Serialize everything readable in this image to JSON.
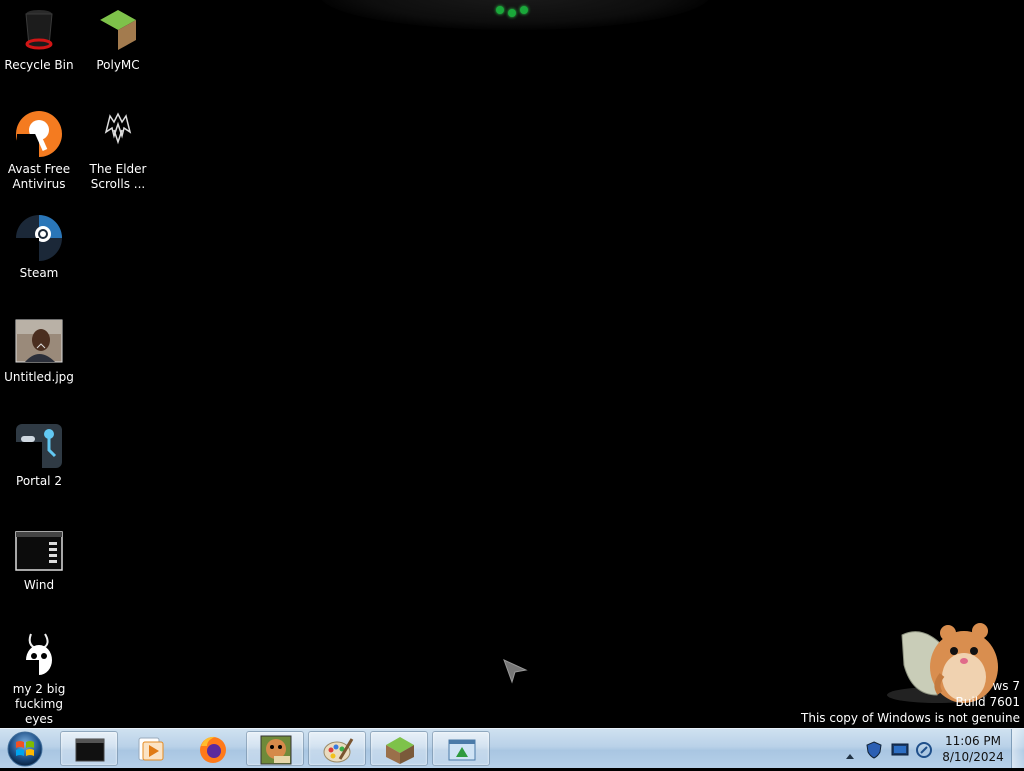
{
  "desktop": {
    "icons": [
      {
        "label": "Recycle Bin",
        "icon": "recycle-bin-icon"
      },
      {
        "label": "PolyMC",
        "icon": "polymc-icon"
      },
      {
        "label": "Avast Free\nAntivirus",
        "icon": "avast-icon"
      },
      {
        "label": "The Elder\nScrolls ...",
        "icon": "elder-scrolls-icon"
      },
      {
        "label": "Steam",
        "icon": "steam-icon"
      },
      {
        "label": "Untitled.jpg",
        "icon": "image-file-icon"
      },
      {
        "label": "Portal 2",
        "icon": "portal-2-icon"
      },
      {
        "label": "Wind",
        "icon": "wind-shortcut-icon"
      },
      {
        "label": "my 2 big\nfuckimg eyes",
        "icon": "bunny-image-icon"
      }
    ]
  },
  "watermark": {
    "line1": "ws 7",
    "line2": "Build 7601",
    "line3": "This copy of Windows is not genuine"
  },
  "taskbar": {
    "start_icon": "windows-orb-icon",
    "buttons": [
      {
        "icon": "cmd-window-icon",
        "active": true
      },
      {
        "icon": "media-player-icon",
        "active": false
      },
      {
        "icon": "firefox-icon",
        "active": false
      },
      {
        "icon": "hamster-box-icon",
        "active": true
      },
      {
        "icon": "paint-icon",
        "active": true
      },
      {
        "icon": "minecraft-icon",
        "active": true
      },
      {
        "icon": "app-window-icon",
        "active": true
      }
    ],
    "tray": {
      "icons": [
        "show-hidden-icons-arrow",
        "security-shield-icon",
        "network-monitor-icon",
        "volume-icon"
      ]
    },
    "clock": {
      "time": "11:06 PM",
      "date": "8/10/2024"
    }
  },
  "colors": {
    "desktop_bg": "#000000",
    "taskbar_top": "#cfe1f0",
    "taskbar_bottom": "#b6d0e9",
    "dock_accent": "#1aa83a"
  }
}
